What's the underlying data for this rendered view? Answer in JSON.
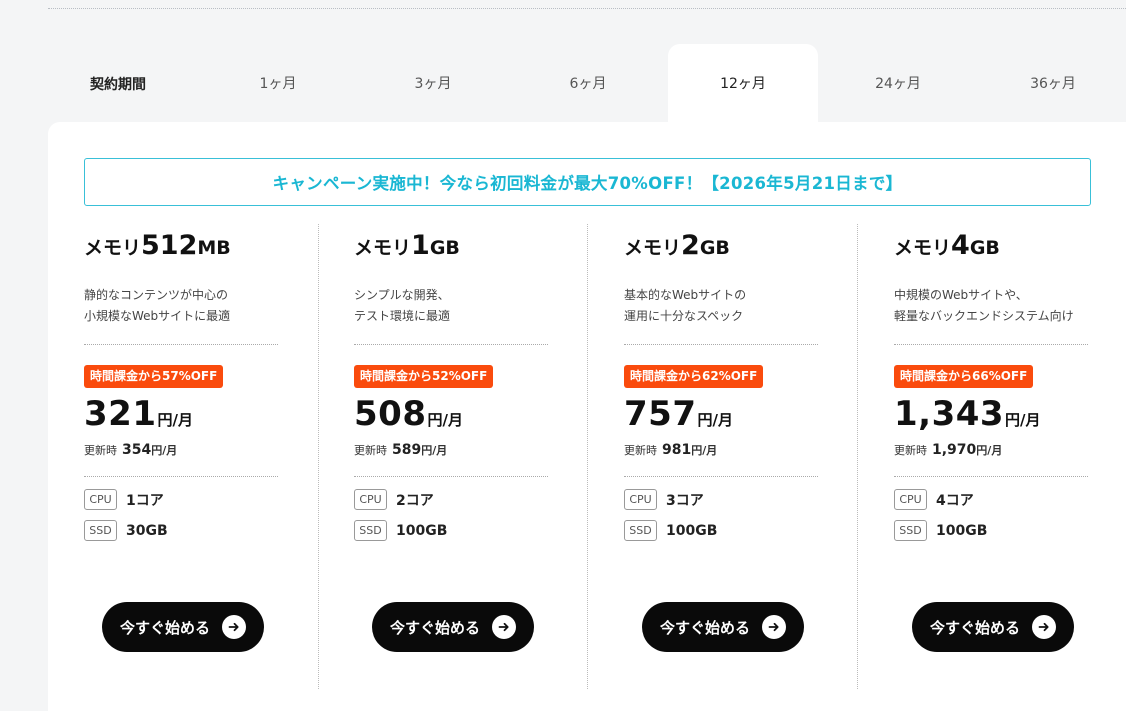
{
  "term": {
    "label": "契約期間",
    "tabs": [
      "1ヶ月",
      "3ヶ月",
      "6ヶ月",
      "12ヶ月",
      "24ヶ月",
      "36ヶ月"
    ],
    "active": "12ヶ月"
  },
  "campaign": "キャンペーン実施中！今なら初回料金が最大70%OFF！【2026年5月21日まで】",
  "plans": [
    {
      "name_prefix": "メモリ",
      "name_size": "512",
      "name_unit": "MB",
      "desc1": "静的なコンテンツが中心の",
      "desc2": "小規模なWebサイトに最適",
      "badge": "時間課金から57%OFF",
      "price": "321",
      "price_unit": "円/月",
      "renew_label": "更新時",
      "renew_price": "354",
      "renew_unit": "円/月",
      "cpu_tag": "CPU",
      "cpu": "1コア",
      "ssd_tag": "SSD",
      "ssd": "30GB",
      "cta": "今すぐ始める"
    },
    {
      "name_prefix": "メモリ",
      "name_size": "1",
      "name_unit": "GB",
      "desc1": "シンプルな開発、",
      "desc2": "テスト環境に最適",
      "badge": "時間課金から52%OFF",
      "price": "508",
      "price_unit": "円/月",
      "renew_label": "更新時",
      "renew_price": "589",
      "renew_unit": "円/月",
      "cpu_tag": "CPU",
      "cpu": "2コア",
      "ssd_tag": "SSD",
      "ssd": "100GB",
      "cta": "今すぐ始める"
    },
    {
      "name_prefix": "メモリ",
      "name_size": "2",
      "name_unit": "GB",
      "desc1": "基本的なWebサイトの",
      "desc2": "運用に十分なスペック",
      "badge": "時間課金から62%OFF",
      "price": "757",
      "price_unit": "円/月",
      "renew_label": "更新時",
      "renew_price": "981",
      "renew_unit": "円/月",
      "cpu_tag": "CPU",
      "cpu": "3コア",
      "ssd_tag": "SSD",
      "ssd": "100GB",
      "cta": "今すぐ始める"
    },
    {
      "name_prefix": "メモリ",
      "name_size": "4",
      "name_unit": "GB",
      "desc1": "中規模のWebサイトや、",
      "desc2": "軽量なバックエンドシステム向け",
      "badge": "時間課金から66%OFF",
      "price": "1,343",
      "price_unit": "円/月",
      "renew_label": "更新時",
      "renew_price": "1,970",
      "renew_unit": "円/月",
      "cpu_tag": "CPU",
      "cpu": "4コア",
      "ssd_tag": "SSD",
      "ssd": "100GB",
      "cta": "今すぐ始める"
    }
  ],
  "colors": {
    "accent": "#1ab7d3",
    "badge": "#fa4b0d",
    "cta": "#0a0a0a"
  },
  "icons": {
    "cta_icon": "arrow-right-circle-icon"
  }
}
